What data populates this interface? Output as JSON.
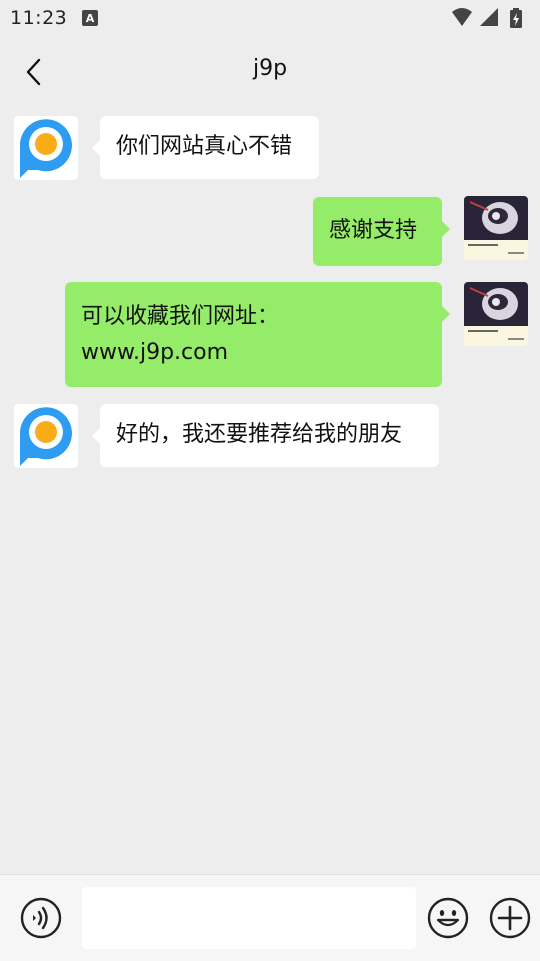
{
  "status_bar": {
    "time": "11:23",
    "notification_icon": "A",
    "icons": [
      "wifi-icon",
      "signal-icon",
      "battery-charging-icon"
    ]
  },
  "header": {
    "title": "j9p",
    "back_icon": "chevron-left-icon"
  },
  "messages": [
    {
      "side": "left",
      "sender_avatar": "p-logo-avatar",
      "text": "你们网站真心不错"
    },
    {
      "side": "right",
      "sender_avatar": "user-avatar",
      "text": "感谢支持"
    },
    {
      "side": "right",
      "sender_avatar": "user-avatar",
      "lines": [
        "可以收藏我们网址：",
        "www.j9p.com"
      ]
    },
    {
      "side": "left",
      "sender_avatar": "p-logo-avatar",
      "text": "好的，我还要推荐给我的朋友"
    }
  ],
  "input_bar": {
    "voice_icon": "voice-icon",
    "text_value": "",
    "emoji_icon": "emoji-icon",
    "plus_icon": "plus-icon"
  },
  "colors": {
    "background": "#ededed",
    "incoming_bubble": "#ffffff",
    "outgoing_bubble": "#95ec69",
    "logo_blue": "#2e9cf0",
    "logo_orange": "#f8ac17"
  }
}
